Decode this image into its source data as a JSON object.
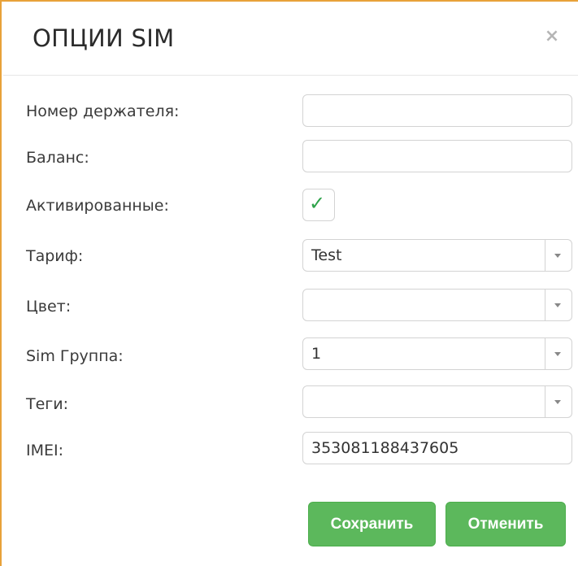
{
  "dialog": {
    "title": "ОПЦИИ SIM",
    "close_glyph": "×"
  },
  "form": {
    "holder_number": {
      "label": "Номер держателя:",
      "value": ""
    },
    "balance": {
      "label": "Баланс:",
      "value": ""
    },
    "activated": {
      "label": "Активированные:",
      "checked": true,
      "check_glyph": "✓"
    },
    "tariff": {
      "label": "Тариф:",
      "value": "Test"
    },
    "color": {
      "label": "Цвет:",
      "value": ""
    },
    "sim_group": {
      "label": "Sim Группа:",
      "value": "1"
    },
    "tags": {
      "label": "Теги:",
      "value": ""
    },
    "imei": {
      "label": "IMEI:",
      "value": "353081188437605"
    }
  },
  "buttons": {
    "save_label": "Сохранить",
    "cancel_label": "Отменить"
  },
  "colors": {
    "accent_border": "#e8a23a",
    "button_green": "#5cb85c",
    "check_green": "#2ea34a"
  },
  "icons": {
    "close": "close-icon",
    "check": "check-icon",
    "dropdown": "chevron-down-icon"
  }
}
